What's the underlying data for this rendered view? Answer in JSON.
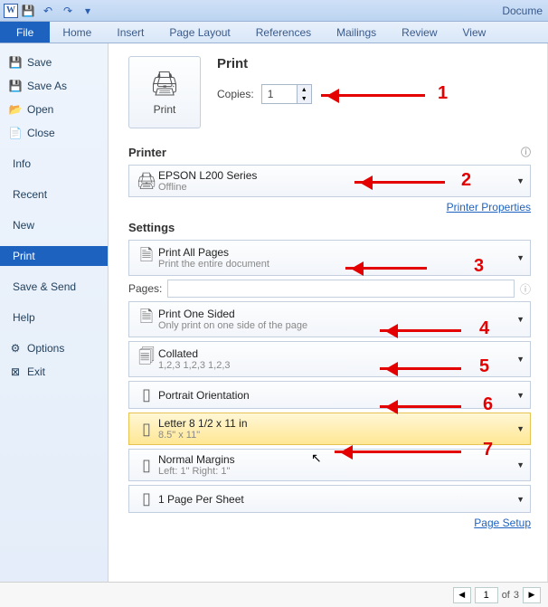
{
  "qat": {
    "doc_title": "Docume"
  },
  "ribbon": {
    "file": "File",
    "tabs": [
      "Home",
      "Insert",
      "Page Layout",
      "References",
      "Mailings",
      "Review",
      "View"
    ]
  },
  "backstage": {
    "save": "Save",
    "save_as": "Save As",
    "open": "Open",
    "close": "Close",
    "info": "Info",
    "recent": "Recent",
    "new": "New",
    "print": "Print",
    "save_send": "Save & Send",
    "help": "Help",
    "options": "Options",
    "exit": "Exit"
  },
  "print": {
    "big_button": "Print",
    "heading": "Print",
    "copies_label": "Copies:",
    "copies_value": "1",
    "printer_heading": "Printer",
    "printer_name": "EPSON L200 Series",
    "printer_status": "Offline",
    "printer_props": "Printer Properties",
    "settings_heading": "Settings",
    "print_all_t1": "Print All Pages",
    "print_all_t2": "Print the entire document",
    "pages_label": "Pages:",
    "pages_value": "",
    "one_sided_t1": "Print One Sided",
    "one_sided_t2": "Only print on one side of the page",
    "collated_t1": "Collated",
    "collated_t2": "1,2,3   1,2,3   1,2,3",
    "orientation": "Portrait Orientation",
    "paper_t1": "Letter 8 1/2 x 11 in",
    "paper_t2": "8.5\" x 11\"",
    "margins_t1": "Normal Margins",
    "margins_t2": "Left: 1\"   Right: 1\"",
    "pages_per_sheet": "1 Page Per Sheet",
    "page_setup": "Page Setup"
  },
  "footer": {
    "page_current": "1",
    "page_sep": "of",
    "page_total": "3"
  },
  "annotations": [
    "1",
    "2",
    "3",
    "4",
    "5",
    "6",
    "7"
  ]
}
